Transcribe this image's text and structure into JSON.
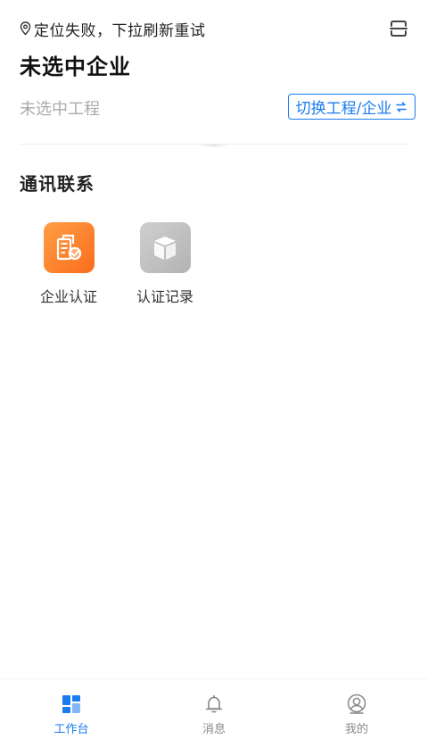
{
  "header": {
    "location_status": "定位失败，下拉刷新重试",
    "company_title": "未选中企业",
    "project_text": "未选中工程",
    "switch_label": "切换工程/企业"
  },
  "section": {
    "title": "通讯联系",
    "items": [
      {
        "label": "企业认证",
        "icon": "certificate-building-icon"
      },
      {
        "label": "认证记录",
        "icon": "box-icon"
      }
    ]
  },
  "tabbar": {
    "tabs": [
      {
        "label": "工作台",
        "icon": "dashboard-icon",
        "active": true
      },
      {
        "label": "消息",
        "icon": "bell-icon",
        "active": false
      },
      {
        "label": "我的",
        "icon": "user-icon",
        "active": false
      }
    ]
  },
  "colors": {
    "accent": "#1a7cf0",
    "orange_icon": "#fa6d1d",
    "gray_icon": "#bdbdbd",
    "muted_text": "#aaaaaa"
  }
}
